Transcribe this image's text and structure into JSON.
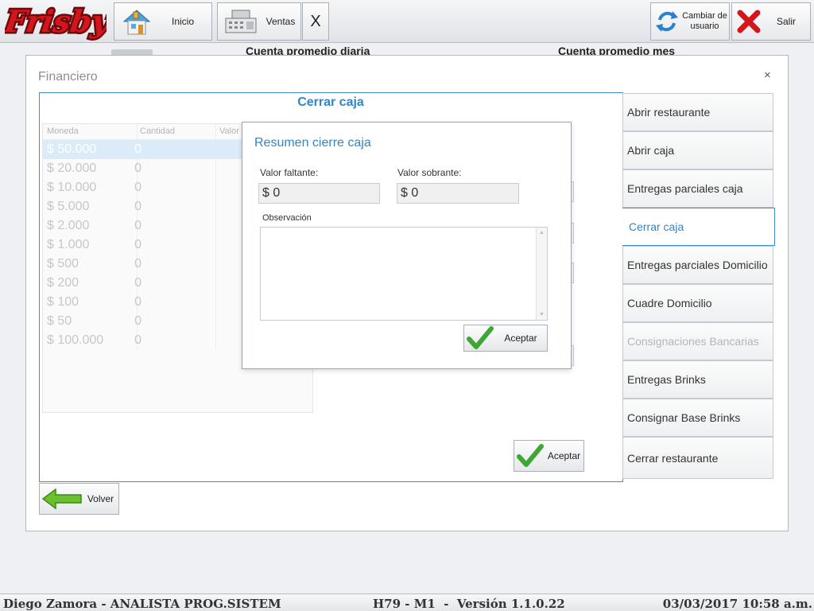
{
  "topbar": {
    "logo_text": "Frisby",
    "inicio_label": "Inicio",
    "ventas_label": "Ventas",
    "close_tab_label": "X",
    "cambiar_usuario_label": "Cambiar de usuario",
    "salir_label": "Salir"
  },
  "background": {
    "cuenta_diaria": "Cuenta promedio diaria",
    "cuenta_mes": "Cuenta promedio mes"
  },
  "financiero": {
    "title": "Financiero",
    "close": "×",
    "panel_title": "Cerrar caja",
    "grid": {
      "headers": [
        "Moneda",
        "Cantidad",
        "Valor"
      ],
      "rows": [
        {
          "moneda": "$ 50.000",
          "cantidad": "0"
        },
        {
          "moneda": "$ 20.000",
          "cantidad": "0"
        },
        {
          "moneda": "$ 10.000",
          "cantidad": "0"
        },
        {
          "moneda": "$ 5.000",
          "cantidad": "0"
        },
        {
          "moneda": "$ 2.000",
          "cantidad": "0"
        },
        {
          "moneda": "$ 1.000",
          "cantidad": "0"
        },
        {
          "moneda": "$ 500",
          "cantidad": "0"
        },
        {
          "moneda": "$ 200",
          "cantidad": "0"
        },
        {
          "moneda": "$ 100",
          "cantidad": "0"
        },
        {
          "moneda": "$ 50",
          "cantidad": "0"
        },
        {
          "moneda": "$ 100.000",
          "cantidad": "0"
        }
      ]
    },
    "aceptar_label": "Aceptar",
    "volver_label": "Volver"
  },
  "menu": [
    {
      "label": "Abrir restaurante"
    },
    {
      "label": "Abrir caja"
    },
    {
      "label": "Entregas parciales caja"
    },
    {
      "label": "Cerrar caja"
    },
    {
      "label": "Entregas parciales Domicilio"
    },
    {
      "label": "Cuadre Domicilio"
    },
    {
      "label": "Consignaciones Bancarias"
    },
    {
      "label": "Entregas Brinks"
    },
    {
      "label": "Consignar Base Brinks"
    },
    {
      "label": "Cerrar restaurante"
    }
  ],
  "resumen": {
    "title": "Resumen cierre caja",
    "faltante_label": "Valor faltante:",
    "faltante_value": "$ 0",
    "sobrante_label": "Valor sobrante:",
    "sobrante_value": "$ 0",
    "observacion_label": "Observación",
    "aceptar_label": "Aceptar"
  },
  "status": {
    "user": "Diego Zamora - ANALISTA PROG.SISTEM",
    "version": "H79 - M1  -  Versión 1.1.0.22",
    "datetime": "03/03/2017 10:58 a.m."
  },
  "colors": {
    "accent": "#2f86c8",
    "logo_red": "#d4151c",
    "check_green": "#3fa535"
  }
}
